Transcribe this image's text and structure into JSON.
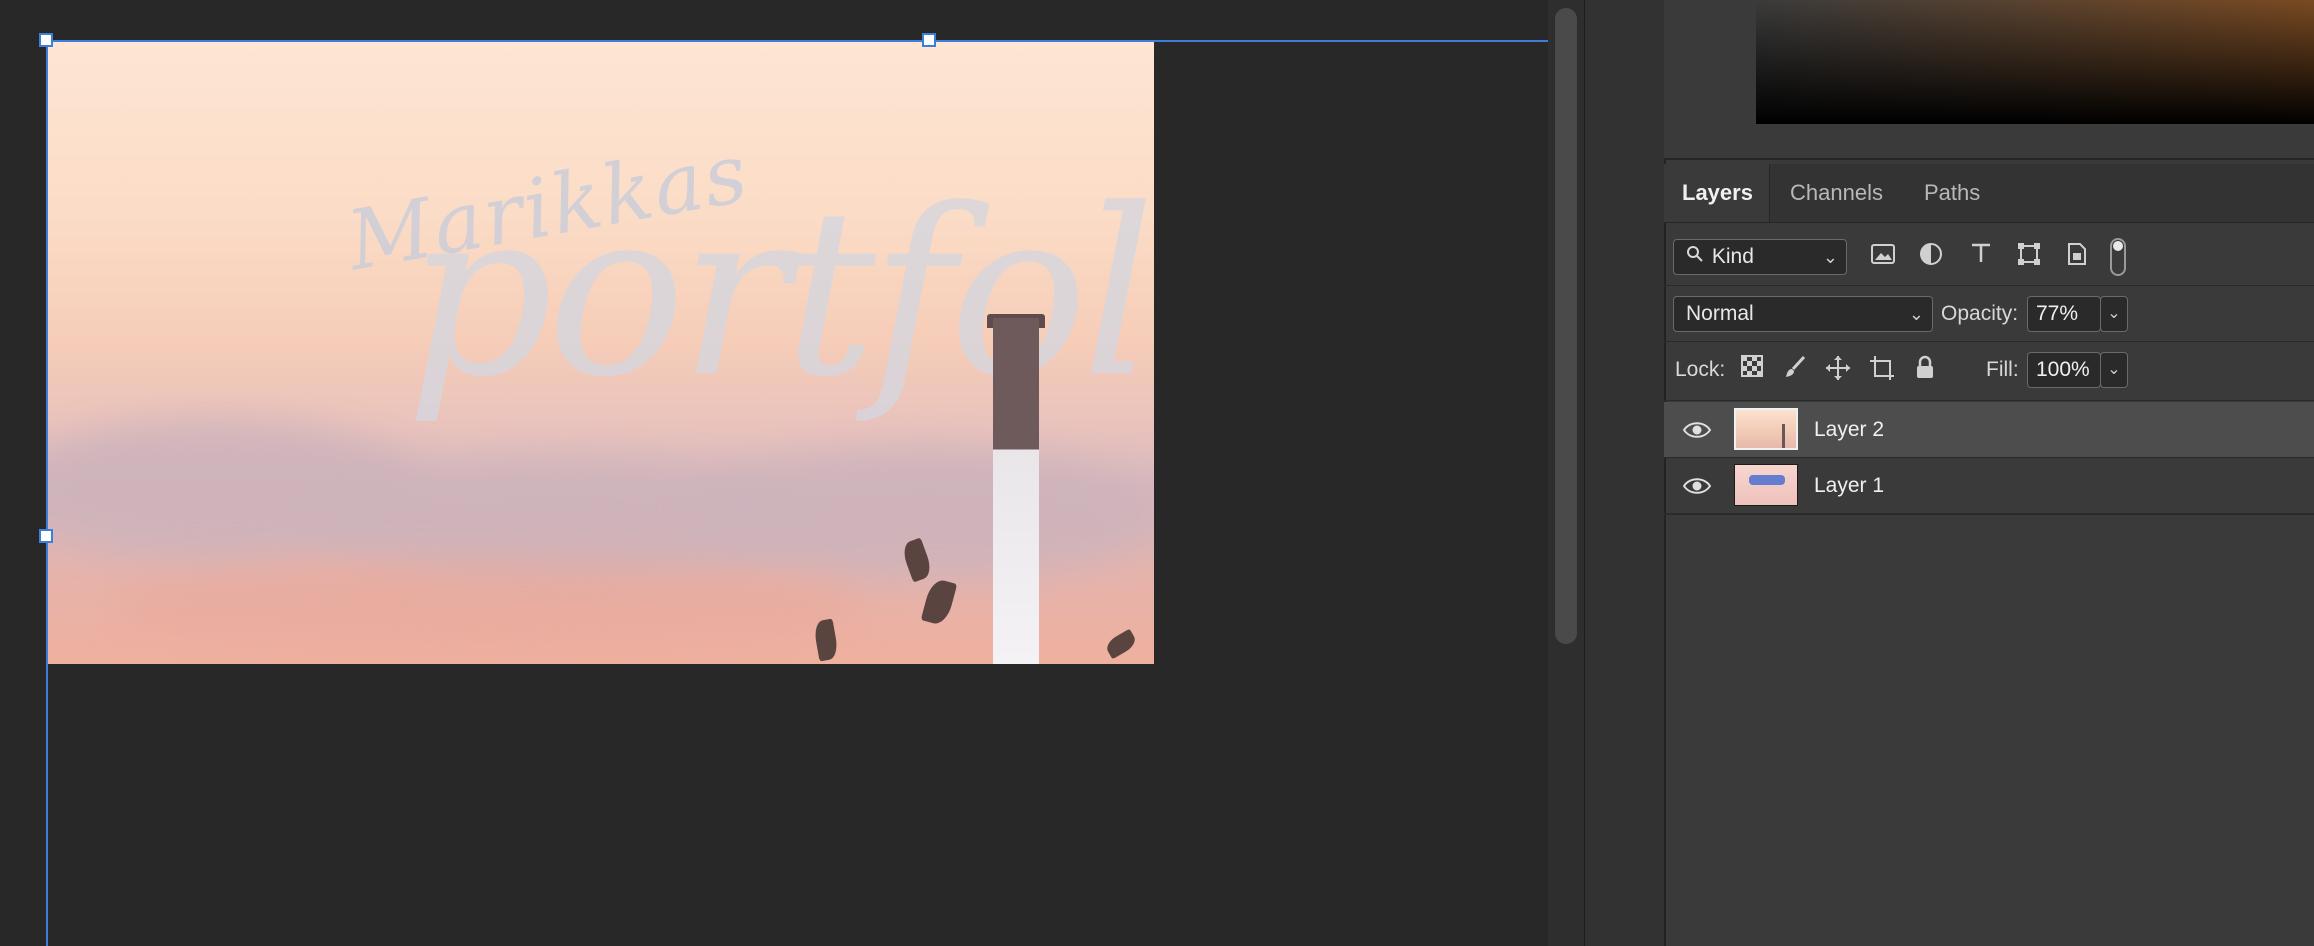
{
  "document": {
    "watermark_small": "Marikkas",
    "watermark_large": "portfolio"
  },
  "layers_panel": {
    "tabs": [
      "Layers",
      "Channels",
      "Paths"
    ],
    "active_tab": "Layers",
    "filter": {
      "value": "Kind"
    },
    "blend_mode": "Normal",
    "opacity_label": "Opacity:",
    "opacity_value": "77%",
    "lock_label": "Lock:",
    "fill_label": "Fill:",
    "fill_value": "100%",
    "filter_icons": [
      "image-filter-icon",
      "adjustment-filter-icon",
      "type-filter-icon",
      "shape-filter-icon",
      "smart-object-filter-icon",
      "filter-toggle-switch"
    ],
    "lock_icons": [
      "lock-transparent-pixels-icon",
      "lock-image-pixels-icon",
      "lock-position-icon",
      "lock-artboard-icon",
      "lock-all-icon"
    ],
    "layers": [
      {
        "name": "Layer 2",
        "selected": true,
        "visible": true
      },
      {
        "name": "Layer 1",
        "selected": false,
        "visible": true
      }
    ]
  },
  "colors": {
    "selection": "#3d7fd8",
    "panel_bg": "#3a3a3a",
    "canvas_bg": "#282828",
    "selected_layer": "#4d4d4d"
  }
}
